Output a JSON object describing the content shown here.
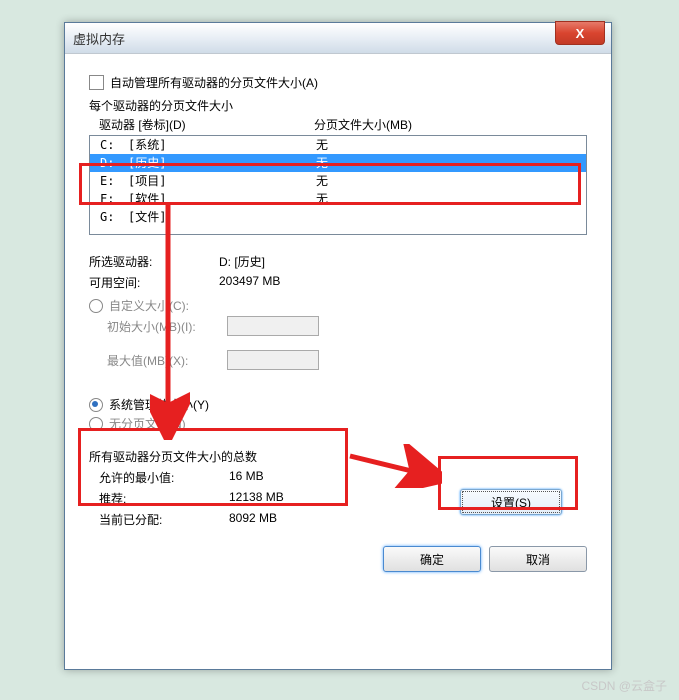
{
  "title": "虚拟内存",
  "close_x": "X",
  "auto_manage": "自动管理所有驱动器的分页文件大小(A)",
  "per_drive": "每个驱动器的分页文件大小",
  "col_drive": "驱动器 [卷标](D)",
  "col_paging": "分页文件大小(MB)",
  "drives": [
    {
      "letter": "C:",
      "label": "[系统]",
      "paging": "无",
      "sel": false
    },
    {
      "letter": "D:",
      "label": "[历史]",
      "paging": "无",
      "sel": true
    },
    {
      "letter": "E:",
      "label": "[项目]",
      "paging": "无",
      "sel": false
    },
    {
      "letter": "F:",
      "label": "[软件]",
      "paging": "无",
      "sel": false
    },
    {
      "letter": "G:",
      "label": "[文件]",
      "paging": "",
      "sel": false
    }
  ],
  "selected_drive_label": "所选驱动器:",
  "selected_drive_value": "D:  [历史]",
  "avail_label": "可用空间:",
  "avail_value": "203497 MB",
  "custom_size": "自定义大小(C):",
  "initial_size": "初始大小(MB)(I):",
  "max_size": "最大值(MB)(X):",
  "system_managed": "系统管理的大小(Y)",
  "no_paging": "无分页文件(N)",
  "set_btn": "设置(S)",
  "totals_title": "所有驱动器分页文件大小的总数",
  "min_label": "允许的最小值:",
  "min_value": "16 MB",
  "rec_label": "推荐:",
  "rec_value": "12138 MB",
  "cur_label": "当前已分配:",
  "cur_value": "8092 MB",
  "ok": "确定",
  "cancel": "取消",
  "watermark": "CSDN @云盒子"
}
